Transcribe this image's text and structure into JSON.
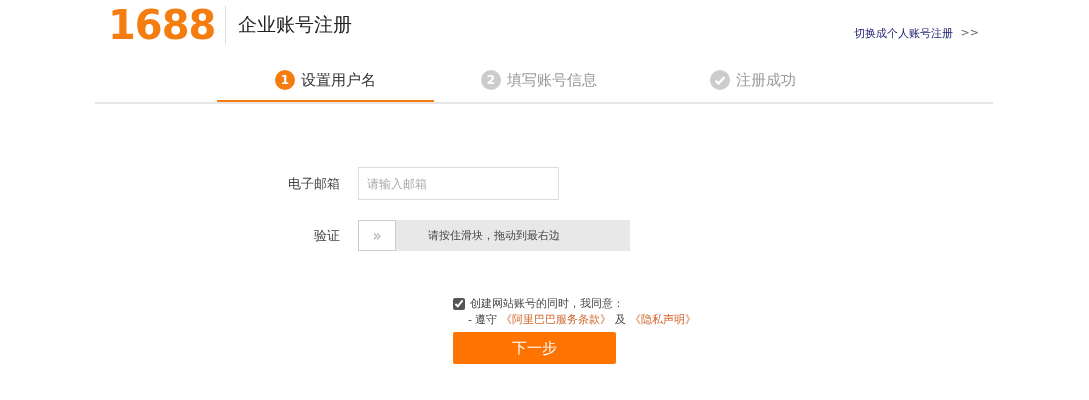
{
  "header": {
    "logo": "1688",
    "title": "企业账号注册",
    "switch_link": "切换成个人账号注册",
    "switch_arrow": ">>"
  },
  "steps": [
    {
      "kind": "number",
      "number": "1",
      "label": "设置用户名",
      "selected": true
    },
    {
      "kind": "number",
      "number": "2",
      "label": "填写账号信息",
      "selected": false
    },
    {
      "kind": "check",
      "label": "注册成功",
      "selected": false
    }
  ],
  "form": {
    "email_label": "电子邮箱",
    "email_placeholder": "请输入邮箱",
    "verify_label": "验证",
    "slider_handle": "»",
    "slider_hint": "请按住滑块，拖动到最右边"
  },
  "agreement": {
    "checked": true,
    "text": "创建网站账号的同时，我同意：",
    "terms_prefix": "- 遵守",
    "terms_link": "《阿里巴巴服务条款》",
    "conjunction": "及",
    "privacy_link": "《隐私声明》"
  },
  "submit": "下一步"
}
